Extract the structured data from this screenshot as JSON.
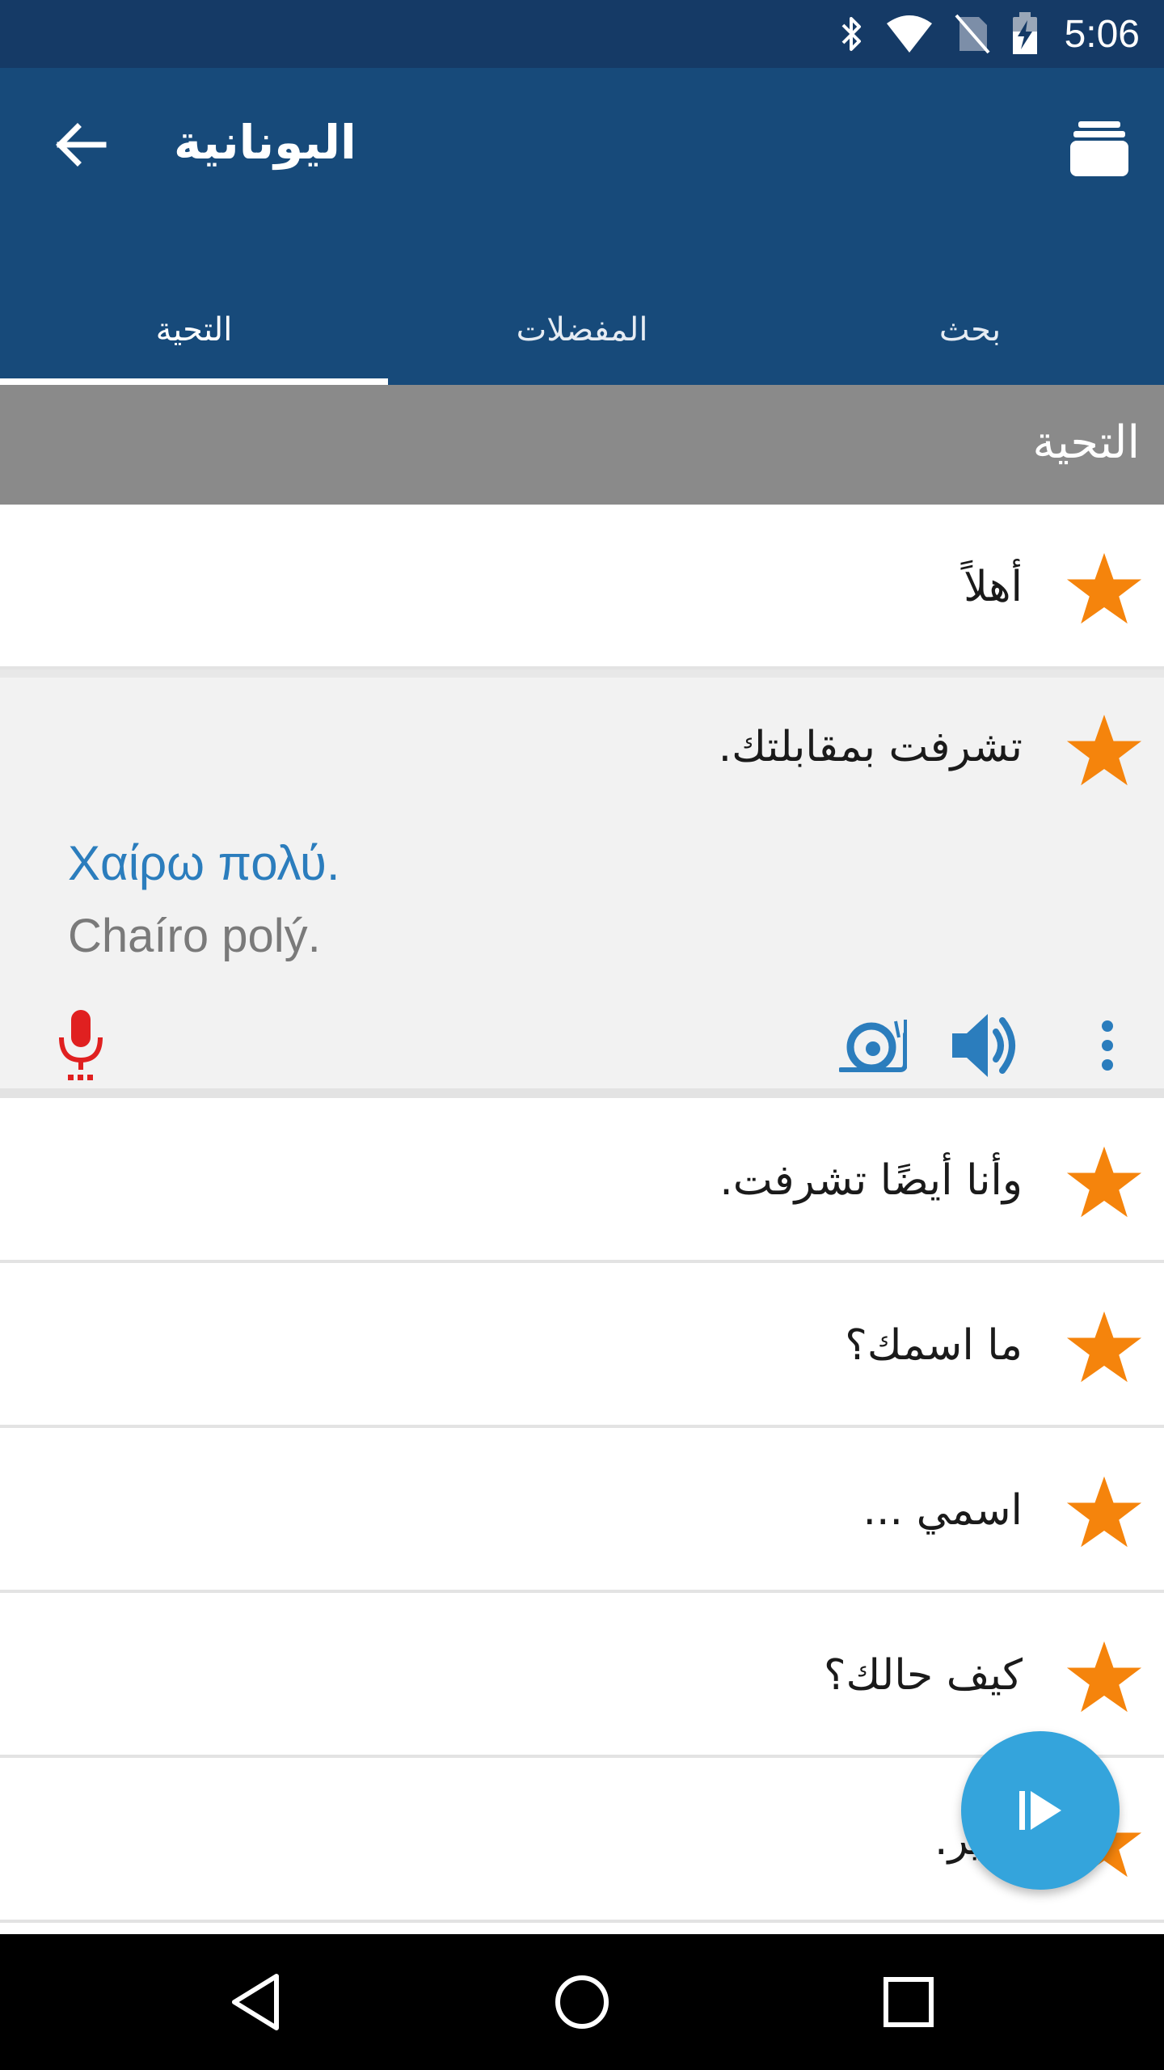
{
  "status_bar": {
    "time": "5:06",
    "icons": [
      "bluetooth-icon",
      "wifi-icon",
      "no-sim-icon",
      "battery-charging-icon"
    ]
  },
  "app_bar": {
    "title": "اليونانية",
    "back_icon": "arrow-back-icon",
    "menu_icon": "stack-icon"
  },
  "tabs": [
    {
      "label": "التحية",
      "active": true
    },
    {
      "label": "المفضلات",
      "active": false
    },
    {
      "label": "بحث",
      "active": false
    }
  ],
  "section": {
    "title": "التحية"
  },
  "phrases": [
    {
      "text": "أهلاً"
    },
    {
      "text": "تشرفت بمقابلتك.",
      "translation": "Χαίρω πολύ.",
      "transliteration": "Chaíro polý."
    },
    {
      "text": "وأنا أيضًا تشرفت."
    },
    {
      "text": "ما اسمك؟"
    },
    {
      "text": "اسمي ..."
    },
    {
      "text": "كيف حالك؟"
    },
    {
      "text": "بخير."
    }
  ],
  "colors": {
    "status_bar": "#153a66",
    "app_bar": "#174a7a",
    "star": "#f5840c",
    "greek_text": "#2b7dbd",
    "mic": "#e02020",
    "fab": "#34a4dc",
    "section_header": "#8a8a8a"
  },
  "nav": [
    "back-triangle-icon",
    "home-circle-icon",
    "recents-square-icon"
  ]
}
